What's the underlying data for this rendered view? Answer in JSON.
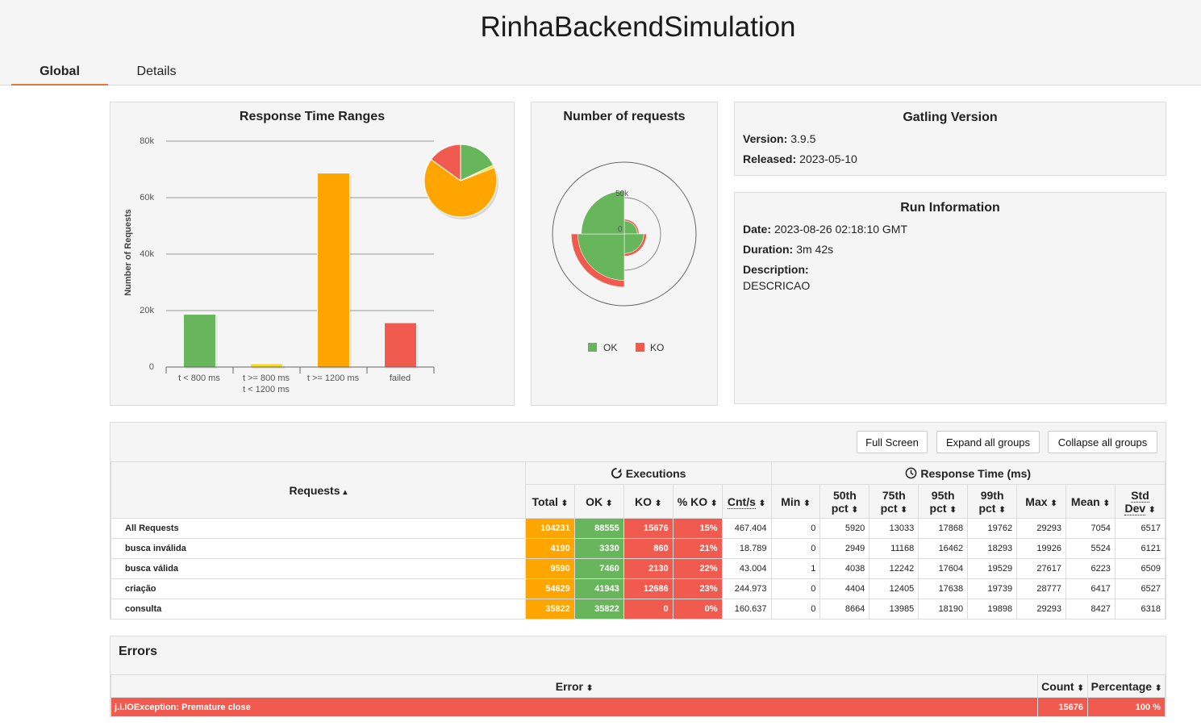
{
  "app": {
    "title": "RinhaBackendSimulation"
  },
  "tabs": {
    "global": "Global",
    "details": "Details"
  },
  "response_time_ranges": {
    "title": "Response Time Ranges",
    "ylabel": "Number of Requests",
    "yticks": [
      "80k",
      "60k",
      "40k",
      "20k",
      "0"
    ],
    "categories": [
      {
        "line1": "t < 800 ms",
        "line2": ""
      },
      {
        "line1": "t >= 800 ms",
        "line2": "t < 1200 ms"
      },
      {
        "line1": "t >= 1200 ms",
        "line2": ""
      },
      {
        "line1": "failed",
        "line2": ""
      }
    ],
    "colors": [
      "#68b65c",
      "#ffdd00",
      "#ffa500",
      "#f15b4f"
    ]
  },
  "number_of_requests": {
    "title": "Number of requests",
    "tick_50k": "50k",
    "tick_0": "0",
    "legend_ok": "OK",
    "legend_ko": "KO"
  },
  "chart_data": [
    {
      "type": "bar",
      "title": "Response Time Ranges",
      "ylabel": "Number of Requests",
      "categories": [
        "t < 800 ms",
        "t >= 800 ms t < 1200 ms",
        "t >= 1200 ms",
        "failed"
      ],
      "values": [
        18700,
        1200,
        68700,
        15700
      ],
      "ylim": [
        0,
        80000
      ]
    },
    {
      "type": "pie",
      "categories": [
        "t < 800 ms",
        "t >= 800 ms t < 1200 ms",
        "t >= 1200 ms",
        "failed"
      ],
      "values": [
        18700,
        1200,
        68700,
        15700
      ]
    },
    {
      "type": "polar-area",
      "title": "Number of requests",
      "categories": [
        "busca inválida",
        "busca válida",
        "criação",
        "consulta"
      ],
      "series": [
        {
          "name": "OK",
          "values": [
            3330,
            7460,
            41943,
            35822
          ]
        },
        {
          "name": "KO",
          "values": [
            860,
            2130,
            12686,
            0
          ]
        }
      ]
    }
  ],
  "gatling_version": {
    "title": "Gatling Version",
    "version_label": "Version:",
    "version": "3.9.5",
    "released_label": "Released:",
    "released": "2023-05-10"
  },
  "run_info": {
    "title": "Run Information",
    "date_label": "Date:",
    "date": "2023-08-26 02:18:10 GMT",
    "duration_label": "Duration:",
    "duration": "3m 42s",
    "description_label": "Description:",
    "description": "DESCRICAO"
  },
  "toolbar": {
    "full_screen": "Full Screen",
    "expand_all": "Expand all groups",
    "collapse_all": "Collapse all groups"
  },
  "stats": {
    "requests_header": "Requests",
    "executions_header": "Executions",
    "response_time_header": "Response Time (ms)",
    "columns": {
      "total": "Total",
      "ok": "OK",
      "ko": "KO",
      "pct_ko": "% KO",
      "cnt_s": "Cnt/s",
      "min": "Min",
      "p50a": "50th",
      "p75a": "75th",
      "p95a": "95th",
      "p99a": "99th",
      "pct": "pct",
      "max": "Max",
      "mean": "Mean",
      "std": "Std",
      "dev": "Dev"
    },
    "rows": [
      {
        "name": "All Requests",
        "total": "104231",
        "ok": "88555",
        "ko": "15676",
        "pct_ko": "15%",
        "cnt_s": "467.404",
        "min": "0",
        "p50": "5920",
        "p75": "13033",
        "p95": "17868",
        "p99": "19762",
        "max": "29293",
        "mean": "7054",
        "std": "6517"
      },
      {
        "name": "busca inválida",
        "total": "4190",
        "ok": "3330",
        "ko": "860",
        "pct_ko": "21%",
        "cnt_s": "18.789",
        "min": "0",
        "p50": "2949",
        "p75": "11168",
        "p95": "16462",
        "p99": "18293",
        "max": "19926",
        "mean": "5524",
        "std": "6121"
      },
      {
        "name": "busca válida",
        "total": "9590",
        "ok": "7460",
        "ko": "2130",
        "pct_ko": "22%",
        "cnt_s": "43.004",
        "min": "1",
        "p50": "4038",
        "p75": "12242",
        "p95": "17604",
        "p99": "19529",
        "max": "27617",
        "mean": "6223",
        "std": "6509"
      },
      {
        "name": "criação",
        "total": "54629",
        "ok": "41943",
        "ko": "12686",
        "pct_ko": "23%",
        "cnt_s": "244.973",
        "min": "0",
        "p50": "4404",
        "p75": "12405",
        "p95": "17638",
        "p99": "19739",
        "max": "28777",
        "mean": "6417",
        "std": "6527"
      },
      {
        "name": "consulta",
        "total": "35822",
        "ok": "35822",
        "ko": "0",
        "pct_ko": "0%",
        "cnt_s": "160.637",
        "min": "0",
        "p50": "8664",
        "p75": "13985",
        "p95": "18190",
        "p99": "19898",
        "max": "29293",
        "mean": "8427",
        "std": "6318"
      }
    ]
  },
  "errors": {
    "title": "Errors",
    "headers": {
      "error": "Error",
      "count": "Count",
      "percentage": "Percentage"
    },
    "rows": [
      {
        "error": "j.i.IOException: Premature close",
        "count": "15676",
        "percentage": "100 %"
      }
    ]
  }
}
